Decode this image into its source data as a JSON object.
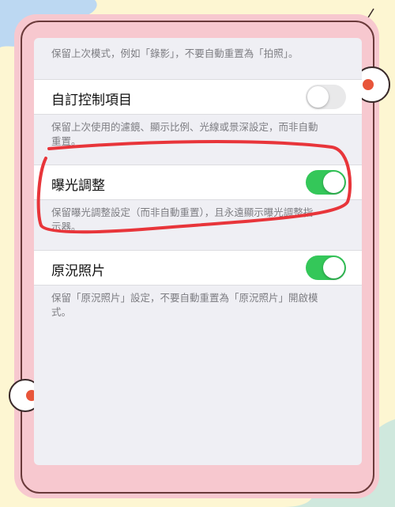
{
  "settings": {
    "top_description": "保留上次模式，例如「錄影」，不要自動重置為「拍照」。",
    "items": [
      {
        "label": "自訂控制項目",
        "enabled": false,
        "description": "保留上次使用的濾鏡、顯示比例、光線或景深設定，而非自動重置。"
      },
      {
        "label": "曝光調整",
        "enabled": true,
        "description": "保留曝光調整設定（而非自動重置），且永遠顯示曝光調整指示器。"
      },
      {
        "label": "原況照片",
        "enabled": true,
        "description": "保留「原況照片」設定，不要自動重置為「原況照片」開啟模式。"
      }
    ]
  },
  "colors": {
    "toggle_on": "#34c759",
    "toggle_off": "#e9e9ea",
    "highlight_circle": "#e8353a"
  },
  "icons": [
    "toggle-switch-icon",
    "flower-sticker-icon",
    "swirl-sticker-icon"
  ]
}
